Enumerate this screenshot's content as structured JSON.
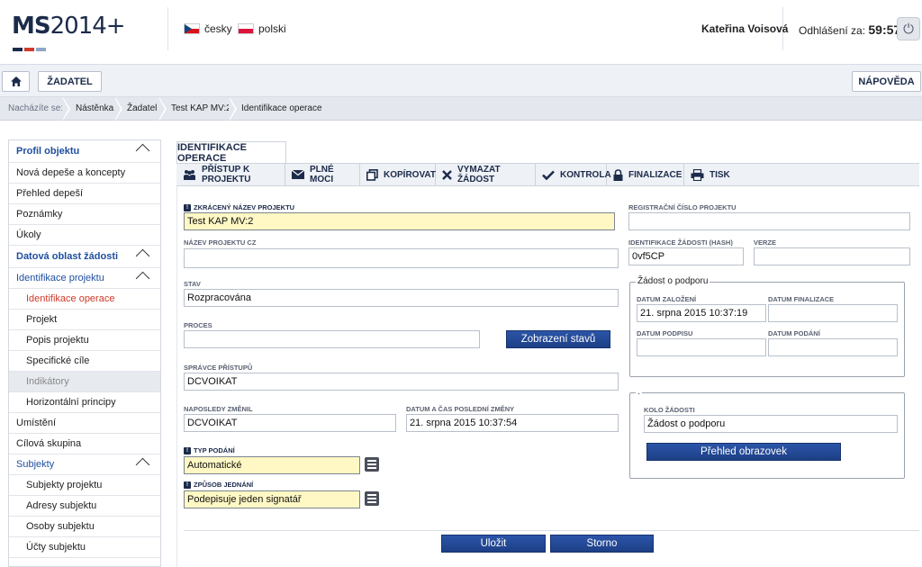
{
  "header": {
    "logo_main": "MS",
    "logo_rest": "2014+",
    "logo_colors": [
      "#1c2b4a",
      "#d03a2a",
      "#8fa6c8"
    ],
    "languages": [
      {
        "flag": "cz-flag-icon",
        "label": "česky"
      },
      {
        "flag": "pl-flag-icon",
        "label": "polski"
      }
    ],
    "user_name": "Kateřina Voisová",
    "logout_label": "Odhlášení za:",
    "logout_time": "59:57"
  },
  "nav": {
    "home_icon": "home-icon",
    "zadatel_label": "ŽADATEL",
    "help_label": "NÁPOVĚDA"
  },
  "breadcrumb": {
    "prefix": "Nacházíte se:",
    "items": [
      "Nástěnka",
      "Žadatel",
      "Test KAP MV:2",
      "Identifikace operace"
    ]
  },
  "sidebar": {
    "items": [
      {
        "label": "Profil objektu",
        "type": "head"
      },
      {
        "label": "Nová depeše a koncepty",
        "type": "item"
      },
      {
        "label": "Přehled depeší",
        "type": "item"
      },
      {
        "label": "Poznámky",
        "type": "item"
      },
      {
        "label": "Úkoly",
        "type": "item"
      },
      {
        "label": "Datová oblast žádosti",
        "type": "head"
      },
      {
        "label": "Identifikace projektu",
        "type": "head-light"
      },
      {
        "label": "Identifikace operace",
        "type": "active"
      },
      {
        "label": "Projekt",
        "type": "sub"
      },
      {
        "label": "Popis projektu",
        "type": "sub"
      },
      {
        "label": "Specifické cíle",
        "type": "sub"
      },
      {
        "label": "Indikátory",
        "type": "disabled"
      },
      {
        "label": "Horizontální principy",
        "type": "sub"
      },
      {
        "label": "Umístění",
        "type": "item"
      },
      {
        "label": "Cílová skupina",
        "type": "item"
      },
      {
        "label": "Subjekty",
        "type": "head-light"
      },
      {
        "label": "Subjekty projektu",
        "type": "sub"
      },
      {
        "label": "Adresy subjektu",
        "type": "sub"
      },
      {
        "label": "Osoby subjektu",
        "type": "sub"
      },
      {
        "label": "Účty subjektu",
        "type": "sub"
      }
    ]
  },
  "tab": {
    "label": "IDENTIFIKACE OPERACE"
  },
  "toolbar": {
    "access": "PŘÍSTUP K PROJEKTU",
    "power": "PLNÉ MOCI",
    "copy": "KOPÍROVAT",
    "delete": "VYMAZAT ŽÁDOST",
    "check": "KONTROLA",
    "finalize": "FINALIZACE",
    "print": "TISK"
  },
  "form": {
    "short_name_label": "ZKRÁCENÝ NÁZEV PROJEKTU",
    "short_name_value": "Test KAP MV:2",
    "name_cz_label": "NÁZEV PROJEKTU CZ",
    "name_cz_value": "",
    "state_label": "STAV",
    "state_value": "Rozpracována",
    "process_label": "PROCES",
    "process_value": "",
    "show_states_button": "Zobrazení stavů",
    "admin_label": "SPRÁVCE PŘÍSTUPŮ",
    "admin_value": "DCVOIKAT",
    "last_changed_label": "NAPOSLEDY ZMĚNIL",
    "last_changed_value": "DCVOIKAT",
    "last_change_date_label": "DATUM A ČAS POSLEDNÍ ZMĚNY",
    "last_change_date_value": "21. srpna 2015 10:37:54",
    "submission_type_label": "TYP PODÁNÍ",
    "submission_type_value": "Automatické",
    "acting_label": "ZPŮSOB JEDNÁNÍ",
    "acting_value": "Podepisuje jeden signatář",
    "reg_number_label": "REGISTRAČNÍ ČÍSLO PROJEKTU",
    "reg_number_value": "",
    "hash_label": "IDENTIFIKACE ŽÁDOSTI (HASH)",
    "hash_value": "0vf5CP",
    "version_label": "VERZE",
    "version_value": "",
    "support_legend": "Žádost o podporu",
    "created_label": "DATUM ZALOŽENÍ",
    "created_value": "21. srpna 2015 10:37:19",
    "finalized_label": "DATUM FINALIZACE",
    "finalized_value": "",
    "signed_label": "DATUM PODPISU",
    "signed_value": "",
    "submitted_label": "DATUM PODÁNÍ",
    "submitted_value": "",
    "round_legend": ".",
    "round_label": "KOLO ŽÁDOSTI",
    "round_value": "Žádost o podporu",
    "overview_button": "Přehled obrazovek"
  },
  "footer": {
    "save_label": "Uložit",
    "cancel_label": "Storno"
  }
}
